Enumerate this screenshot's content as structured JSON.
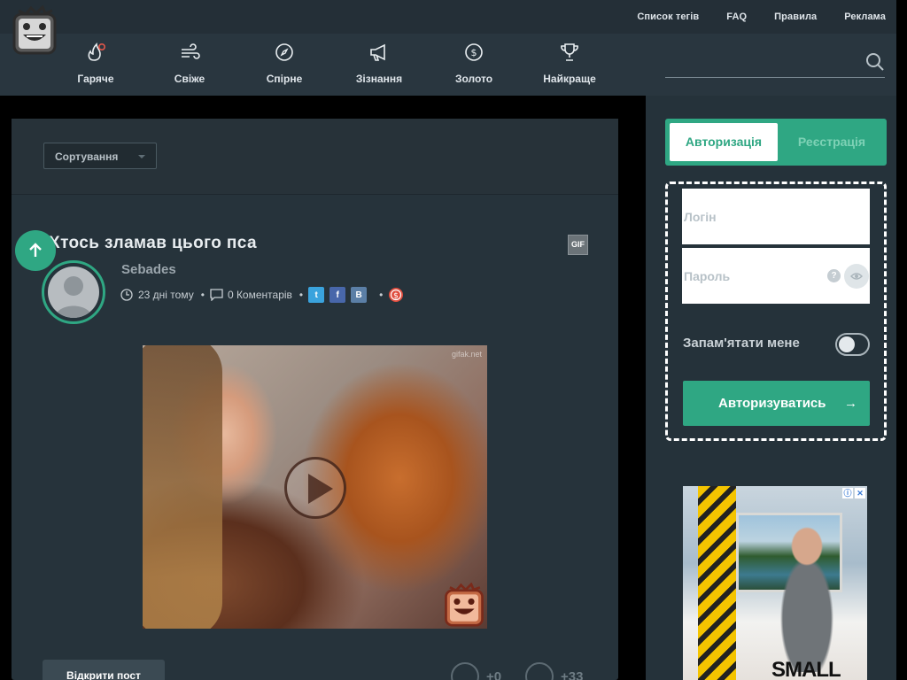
{
  "header": {
    "top_links": [
      "Список тегів",
      "FAQ",
      "Правила",
      "Реклама"
    ],
    "nav": [
      {
        "label": "Гаряче",
        "icon": "flame-icon"
      },
      {
        "label": "Свіже",
        "icon": "wind-icon"
      },
      {
        "label": "Спірне",
        "icon": "compass-icon"
      },
      {
        "label": "Зізнання",
        "icon": "megaphone-icon"
      },
      {
        "label": "Золото",
        "icon": "coin-icon"
      },
      {
        "label": "Найкраще",
        "icon": "trophy-icon"
      }
    ]
  },
  "sort": {
    "label": "Сортування"
  },
  "post": {
    "title": "Хтось зламав цього пса",
    "badge": "GIF",
    "author": "Sebades",
    "time": "23 дні тому",
    "comments": "0 Коментарів",
    "share": [
      "t",
      "f",
      "В"
    ],
    "watermark": "gifak.net",
    "open_label": "Відкрити пост",
    "votes": {
      "plus": "+0",
      "rating": "+33"
    }
  },
  "auth": {
    "tab_login": "Авторизація",
    "tab_register": "Реєстрація",
    "login_placeholder": "Логін",
    "password_placeholder": "Пароль",
    "help": "?",
    "remember": "Запам'ятати мене",
    "submit": "Авторизуватись",
    "submit_arrow": "→"
  },
  "ad": {
    "text": "SMALL",
    "badges": [
      "ⓘ",
      "✕"
    ]
  },
  "colors": {
    "accent": "#2fa783",
    "header": "#242f37",
    "nav": "#29363f",
    "panel": "#26333b"
  }
}
